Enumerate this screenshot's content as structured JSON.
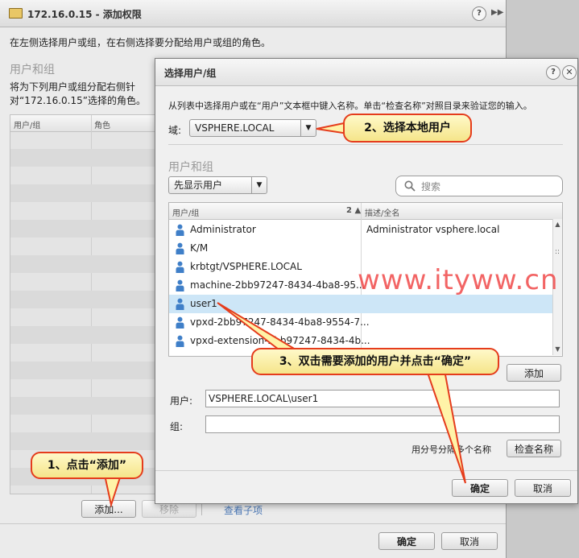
{
  "outer": {
    "title": "172.16.0.15 - 添加权限",
    "instruction": "在左侧选择用户或组，在右侧选择要分配给用户或组的角色。",
    "section": "用户和组",
    "assign_text": "将为下列用户或组分配右侧针对“172.16.0.15”选择的角色。",
    "col_users": "用户/组",
    "col_role": "角色",
    "add_label": "添加...",
    "remove_label": "移除",
    "check_label": "查看子项",
    "ok_label": "确定",
    "cancel_label": "取消"
  },
  "inner": {
    "title": "选择用户/组",
    "instruction": "从列表中选择用户或在“用户”文本框中键入名称。单击“检查名称”对照目录来验证您的输入。",
    "domain_label": "域:",
    "domain_value": "VSPHERE.LOCAL",
    "section": "用户和组",
    "filter_value": "先显示用户",
    "search_placeholder": "搜索",
    "col_name": "用户/组",
    "sort_indicator": "2 ▲",
    "col_desc": "描述/全名",
    "rows": [
      {
        "name": "Administrator",
        "desc": "Administrator vsphere.local"
      },
      {
        "name": "K/M",
        "desc": ""
      },
      {
        "name": "krbtgt/VSPHERE.LOCAL",
        "desc": ""
      },
      {
        "name": "machine-2bb97247-8434-4ba8-95...",
        "desc": ""
      },
      {
        "name": "user1",
        "desc": ""
      },
      {
        "name": "vpxd-2bb97247-8434-4ba8-9554-7...",
        "desc": ""
      },
      {
        "name": "vpxd-extension-2bb97247-8434-4b...",
        "desc": ""
      }
    ],
    "add_label": "添加",
    "user_label": "用户:",
    "user_value": "VSPHERE.LOCAL\\user1",
    "group_label": "组:",
    "group_value": "",
    "separator_hint": "用分号分隔多个名称",
    "check_label": "检查名称",
    "ok_label": "确定",
    "cancel_label": "取消"
  },
  "callouts": {
    "c1": "1、点击“添加”",
    "c2": "2、选择本地用户",
    "c3": "3、双击需要添加的用户并点击“确定”"
  },
  "watermark": "www.ityww.cn",
  "colors": {
    "accent": "#e53c1c",
    "callout_fill": "#fff3a8",
    "selection": "#cde6f7",
    "user_icon": "#3f7fc8"
  }
}
